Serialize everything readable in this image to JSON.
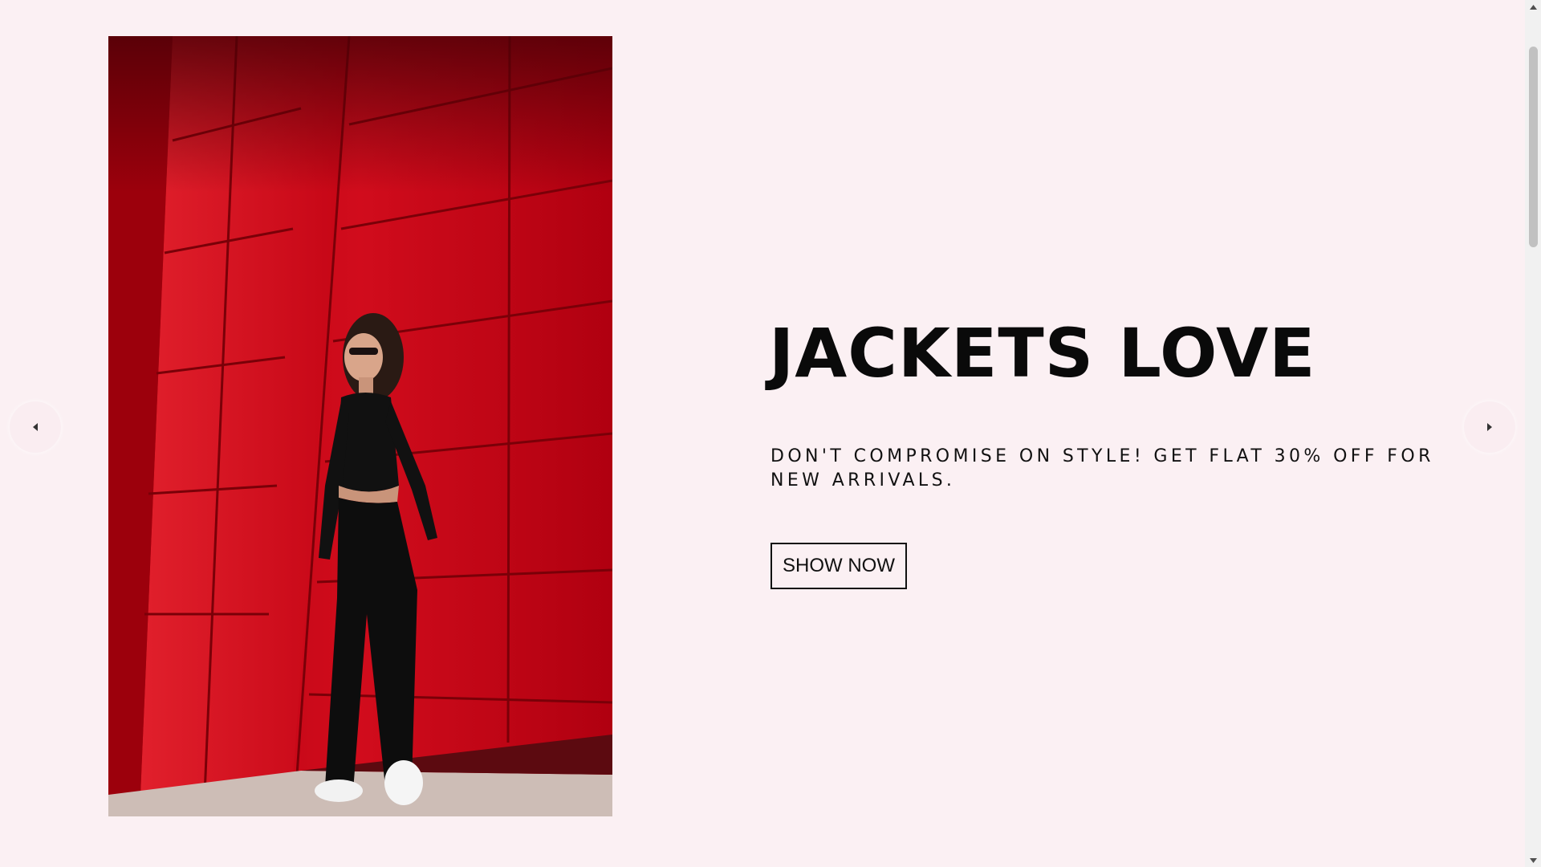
{
  "hero": {
    "title": "JACKETS LOVE",
    "subtitle": "DON'T COMPROMISE ON STYLE! GET FLAT 30% OFF FOR NEW ARRIVALS.",
    "button_label": "SHOW NOW",
    "image_subject": "woman-in-black-outfit-against-red-wall"
  },
  "carousel": {
    "prev_icon": "caret-left-icon",
    "next_icon": "caret-right-icon"
  },
  "colors": {
    "background": "#fbf0f3",
    "text": "#0a0a0a",
    "image_accent": "#c50012"
  }
}
